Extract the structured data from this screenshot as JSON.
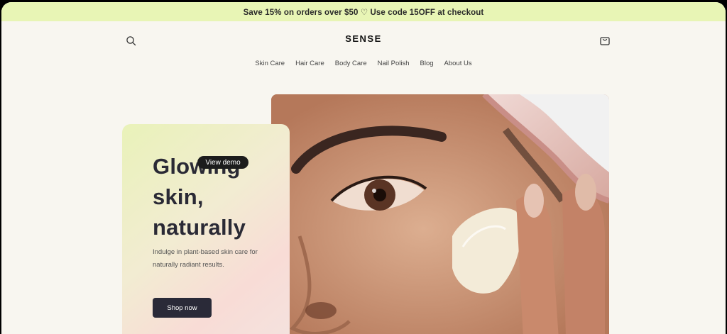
{
  "announcement": {
    "text": "Save 15% on orders over $50 ♡ Use code 15OFF at checkout"
  },
  "header": {
    "logo": "SENSE",
    "search_icon": "search-icon",
    "cart_icon": "cart-icon"
  },
  "nav": {
    "items": [
      {
        "label": "Skin Care"
      },
      {
        "label": "Hair Care"
      },
      {
        "label": "Body Care"
      },
      {
        "label": "Nail Polish"
      },
      {
        "label": "Blog"
      },
      {
        "label": "About Us"
      }
    ]
  },
  "hero": {
    "title_lines": [
      "Glowing",
      "skin,",
      "naturally"
    ],
    "description": "Indulge in plant-based skin care for naturally radiant results.",
    "cta_label": "Shop now"
  },
  "demo_badge": {
    "label": "View demo"
  },
  "colors": {
    "announcement_bg": "#e8f5b5",
    "page_bg": "#f8f6f0",
    "button_bg": "#2a2a38",
    "heading": "#2a2a35"
  }
}
